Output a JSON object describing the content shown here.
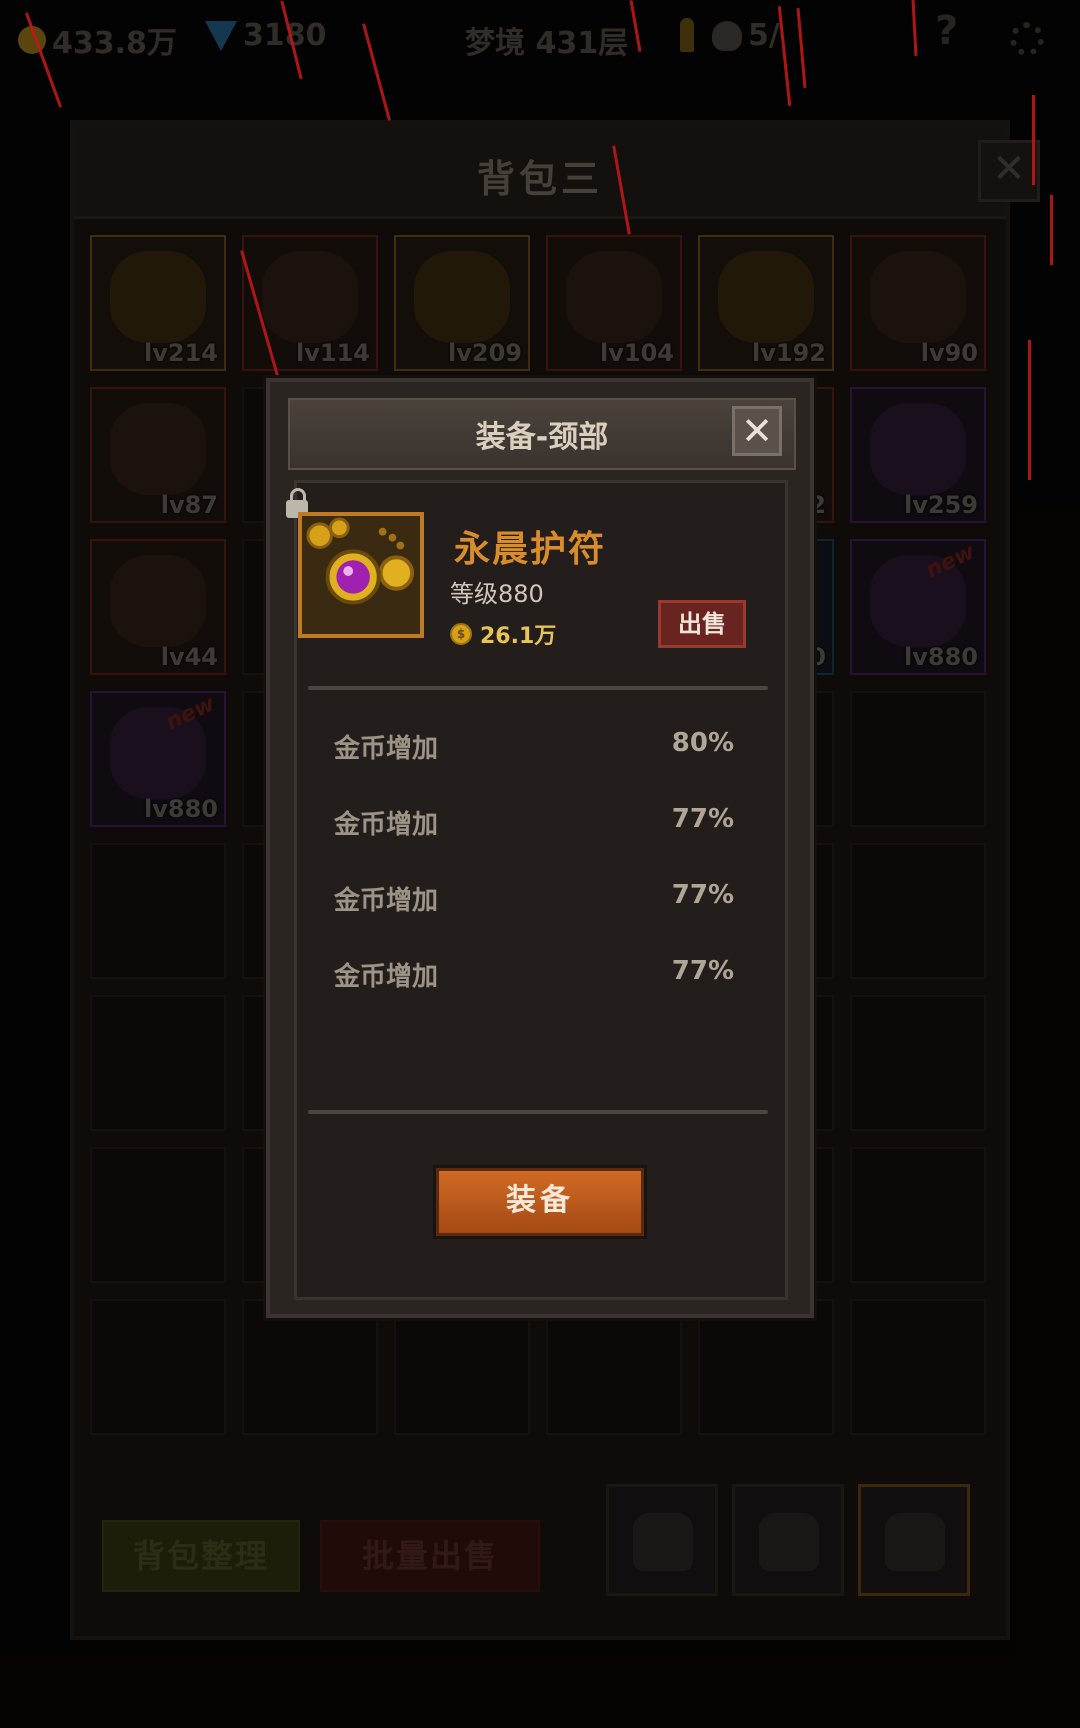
{
  "topbar": {
    "gold": "433.8万",
    "gems": "3180",
    "dungeon": "梦境 431层",
    "skulls": "5/"
  },
  "bag": {
    "title": "背包三",
    "close": "✕",
    "sort_label": "背包整理",
    "bulk_sell_label": "批量出售",
    "slots": [
      {
        "lv": "lv214",
        "rarity": "gold"
      },
      {
        "lv": "lv114",
        "rarity": "red"
      },
      {
        "lv": "lv209",
        "rarity": "gold"
      },
      {
        "lv": "lv104",
        "rarity": "red"
      },
      {
        "lv": "lv192",
        "rarity": "gold"
      },
      {
        "lv": "lv90",
        "rarity": "red"
      },
      {
        "lv": "lv87",
        "rarity": "red"
      },
      {
        "lv": "2",
        "rarity": "red"
      },
      {
        "lv": "lv259",
        "rarity": "purple"
      },
      {
        "lv": "lv44",
        "rarity": "red"
      },
      {
        "lv": "0",
        "rarity": "blue"
      },
      {
        "lv": "lv880",
        "rarity": "purple",
        "new": "new"
      },
      {
        "lv": "lv880",
        "rarity": "purple",
        "new": "new"
      }
    ]
  },
  "modal": {
    "title": "装备-颈部",
    "close": "✕",
    "item_name": "永晨护符",
    "item_level": "等级880",
    "item_price": "26.1万",
    "sell_label": "出售",
    "stats": [
      {
        "name": "金币增加",
        "value": "80%"
      },
      {
        "name": "金币增加",
        "value": "77%"
      },
      {
        "name": "金币增加",
        "value": "77%"
      },
      {
        "name": "金币增加",
        "value": "77%"
      }
    ],
    "equip_label": "装备"
  },
  "colors": {
    "accent_orange": "#c86020",
    "item_name": "#d98c2c",
    "sell_red": "#6a2420"
  }
}
